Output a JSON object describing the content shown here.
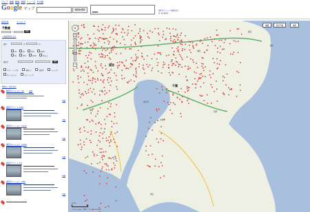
{
  "top_nav": [
    "ウェブ",
    "画像",
    "動画",
    "地図",
    "ニュース",
    "ショッピング",
    "Gmail",
    "その他"
  ],
  "logo": {
    "brand": "Google",
    "product": "マップ"
  },
  "search": {
    "button": "地図を検索",
    "hint": "検索オプション  地図を表示",
    "hint2": "例: 東京都港区"
  },
  "sidebar": {
    "top_links": [
      "検索結果",
      "マイマップ"
    ],
    "title": "不動産",
    "sub_link": "« 検索結果に戻る",
    "filters": {
      "row1": [
        "賃料",
        "円",
        "〜",
        "円"
      ],
      "options_a": [
        "1R",
        "1K",
        "1DK",
        "1LDK"
      ],
      "options_b": [
        "2K",
        "2DK",
        "2LDK",
        "3K以上"
      ],
      "row_walk": "駅徒歩",
      "search_btn": "検索",
      "extras": [
        "バス・トイレ別",
        "2階以上",
        "駐車場",
        "ペット可",
        "オートロック",
        "フローリング"
      ]
    },
    "section_link": "物件の一覧を表示",
    "results": [
      {
        "title": "賃貸マンション 1K",
        "tag": "詳細",
        "link": "地図"
      },
      {
        "title": "賃貸アパート 1DK",
        "tag": "詳細",
        "link": "地図"
      },
      {
        "title": "賃貸マンション 2LDK",
        "tag": "詳細",
        "link": "地図"
      },
      {
        "title": "賃貸マンション 1LDK",
        "tag": "詳細",
        "link": "地図"
      },
      {
        "title": "賃貸アパート 1R",
        "tag": "詳細",
        "link": "地図"
      },
      {
        "title": "賃貸マンション 2DK",
        "tag": "詳細",
        "link": "地図"
      }
    ]
  },
  "map": {
    "type_buttons": [
      "地図",
      "航空写真",
      "地形"
    ],
    "labels": {
      "tokyo": "東京",
      "chiba": "千葉",
      "yokohama": "横浜",
      "kawasaki": "川崎",
      "kisarazu": "木更津",
      "tateyama": "館山",
      "narita": "成田",
      "kashima": "鹿島",
      "tokyo_bay": "東京湾",
      "miura": "三浦",
      "choshi": "銚子",
      "mobara": "茂原"
    },
    "copyright": "©2009 Google - 地図データ ©2009 ZENRIN",
    "scale": "20 km",
    "colors": {
      "land": "#eef0e4",
      "sea": "#a9bfde",
      "marker": "#d9423c",
      "road": "#f2c94c",
      "highway": "#5fb06a"
    }
  }
}
